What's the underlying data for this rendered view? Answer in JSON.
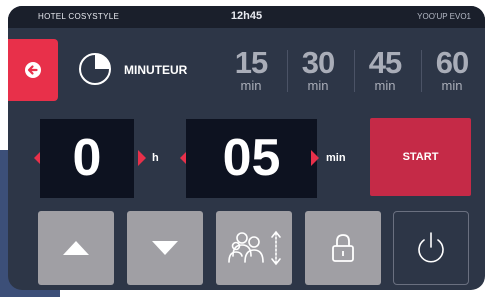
{
  "header": {
    "hotel_name": "HOTEL COSYSTYLE",
    "clock": "12h45",
    "device_model": "YOO'UP EVO1"
  },
  "mode": {
    "label": "MINUTEUR"
  },
  "presets": [
    {
      "value": "15",
      "unit": "min"
    },
    {
      "value": "30",
      "unit": "min"
    },
    {
      "value": "45",
      "unit": "min"
    },
    {
      "value": "60",
      "unit": "min"
    }
  ],
  "timer": {
    "hours": "0",
    "hours_unit": "h",
    "minutes": "05",
    "minutes_unit": "min"
  },
  "start_label": "START",
  "icons": {
    "back": "back-arrow-icon",
    "timer": "timer-pie-icon",
    "up": "up-arrow-icon",
    "down": "down-arrow-icon",
    "guests": "guests-icon",
    "lock": "lock-icon",
    "power": "power-icon"
  },
  "colors": {
    "accent_red": "#e8304a",
    "start_red": "#c52a47",
    "panel": "#2d3647",
    "display_bg": "#0d1220",
    "control_grey": "#a09fa4"
  }
}
